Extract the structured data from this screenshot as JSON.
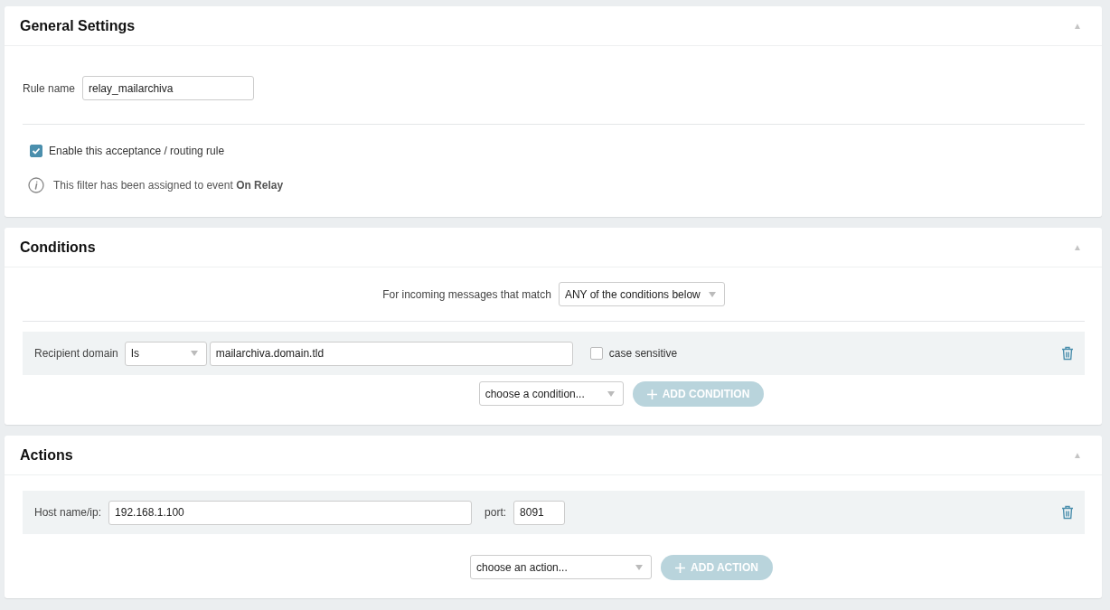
{
  "general": {
    "title": "General Settings",
    "collapse_icon": "▲",
    "rule_name_label": "Rule name",
    "rule_name": "relay_mailarchiva",
    "enable": {
      "label": "Enable this acceptance / routing rule",
      "checked": true
    },
    "info": "This filter has been assigned to event **On Relay**"
  },
  "conditions": {
    "title": "Conditions",
    "collapse_icon": "▲",
    "match_label": "For incoming messages that match",
    "match_value": "ANY of the conditions below",
    "rows": [
      {
        "label": "Recipient domain",
        "operator": "Is",
        "value": "mailarchiva.domain.tld",
        "case_sensitive": {
          "label": "case sensitive",
          "checked": false
        }
      }
    ],
    "add_select": "choose a condition...",
    "add_button": {
      "label": "ADD CONDITION",
      "disabled": true
    }
  },
  "actions": {
    "title": "Actions",
    "collapse_icon": "▲",
    "rows": [
      {
        "host_label": "Host name/ip:",
        "host": "192.168.1.100",
        "port_label": "port:",
        "port": "8091"
      }
    ],
    "add_select": "choose an action...",
    "add_button": {
      "label": "ADD ACTION",
      "disabled": true
    }
  }
}
